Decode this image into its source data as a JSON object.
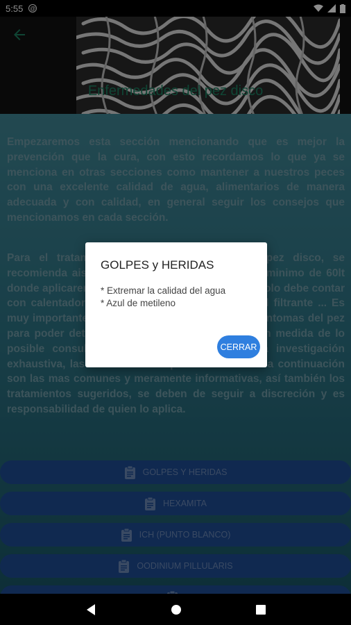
{
  "status_bar": {
    "time": "5:55"
  },
  "header": {
    "title": "Enfermedades del pez disco"
  },
  "content": {
    "paragraph1": "Empezaremos esta sección mencionando que es mejor la prevención que la cura, con esto recordamos lo que ya se menciona en otras secciones como mantener a nuestros peces con una excelente calidad de agua, alimentarios de manera adecuada y con calidad, en general seguir los consejos que mencionamos en cada sección.",
    "paragraph2": "Para el tratamiento de enfermedades en el pez disco, se recomienda aislar al pez enfermo en un acuario minimo de 60lt donde aplicaremos el tratamiento, dicho acuario solo debe contar con calentador y un filtro con esponja y material filtrante ... Es muy importante realizar una observación de los sintomas del pez para poder determinar el tipo de tratamiento y en medida de lo posible consultar a un experto o realizar una investigación exhaustiva, las enfermedades que se mencionan a continuación son las mas comunes y meramente informativas, así también los tratamientos sugeridos, se deben de seguir a discreción y es responsabilidad de quien lo aplica."
  },
  "disease_buttons": [
    {
      "label": "GOLPES y HERIDAS"
    },
    {
      "label": "HEXAMITA"
    },
    {
      "label": "ICH (PUNTO BLANCO)"
    },
    {
      "label": "OODINIUM PILLULARIS"
    },
    {
      "label": ""
    }
  ],
  "dialog": {
    "title": "GOLPES y HERIDAS",
    "lines": [
      "* Extremar la calidad del agua",
      "* Azul de metileno"
    ],
    "close_label": "CERRAR"
  },
  "colors": {
    "accent": "#2f7fdf",
    "button_bg": "#1e4c93",
    "title_green": "#1d7e60"
  }
}
